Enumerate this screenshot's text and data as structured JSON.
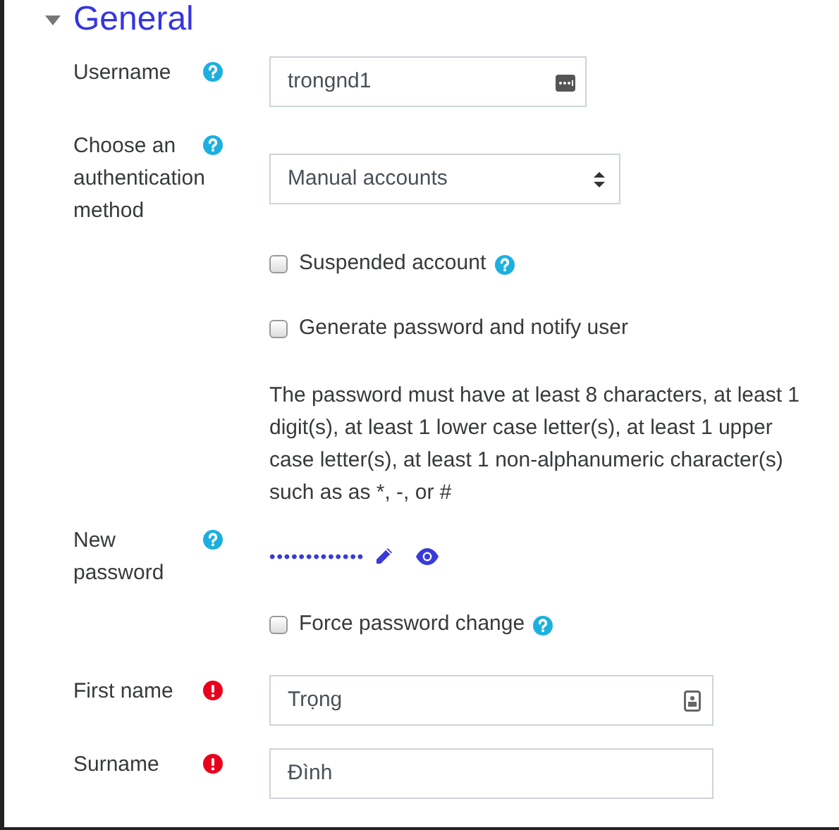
{
  "section": {
    "title": "General",
    "expanded": true
  },
  "rows": [
    {
      "kind": "text",
      "label": "Username",
      "help": true,
      "required": false,
      "value": "trongnd1",
      "key_autofill": true,
      "contact_autofill": false
    },
    {
      "kind": "select",
      "label": "Choose an authentication method",
      "help": true,
      "required": false,
      "value": "Manual accounts"
    },
    {
      "kind": "checkbox",
      "label": "Suspended account",
      "checked": false,
      "help": true
    },
    {
      "kind": "checkbox",
      "label": "Generate password and notify user",
      "checked": false,
      "help": false
    },
    {
      "kind": "note",
      "text": "The password must have at least 8 characters, at least 1 digit(s), at least 1 lower case letter(s), at least 1 upper case letter(s), at least 1 non-alphanumeric character(s) such as as *, -, or #"
    },
    {
      "kind": "password",
      "label": "New password",
      "help": true,
      "required": false,
      "value": "•••••••••••••"
    },
    {
      "kind": "checkbox",
      "label": "Force password change",
      "checked": false,
      "help": true
    },
    {
      "kind": "text",
      "label": "First name",
      "help": false,
      "required": true,
      "value": "Trọng",
      "key_autofill": false,
      "contact_autofill": true
    },
    {
      "kind": "text",
      "label": "Surname",
      "help": false,
      "required": true,
      "value": "Đình",
      "key_autofill": false,
      "contact_autofill": false
    }
  ]
}
